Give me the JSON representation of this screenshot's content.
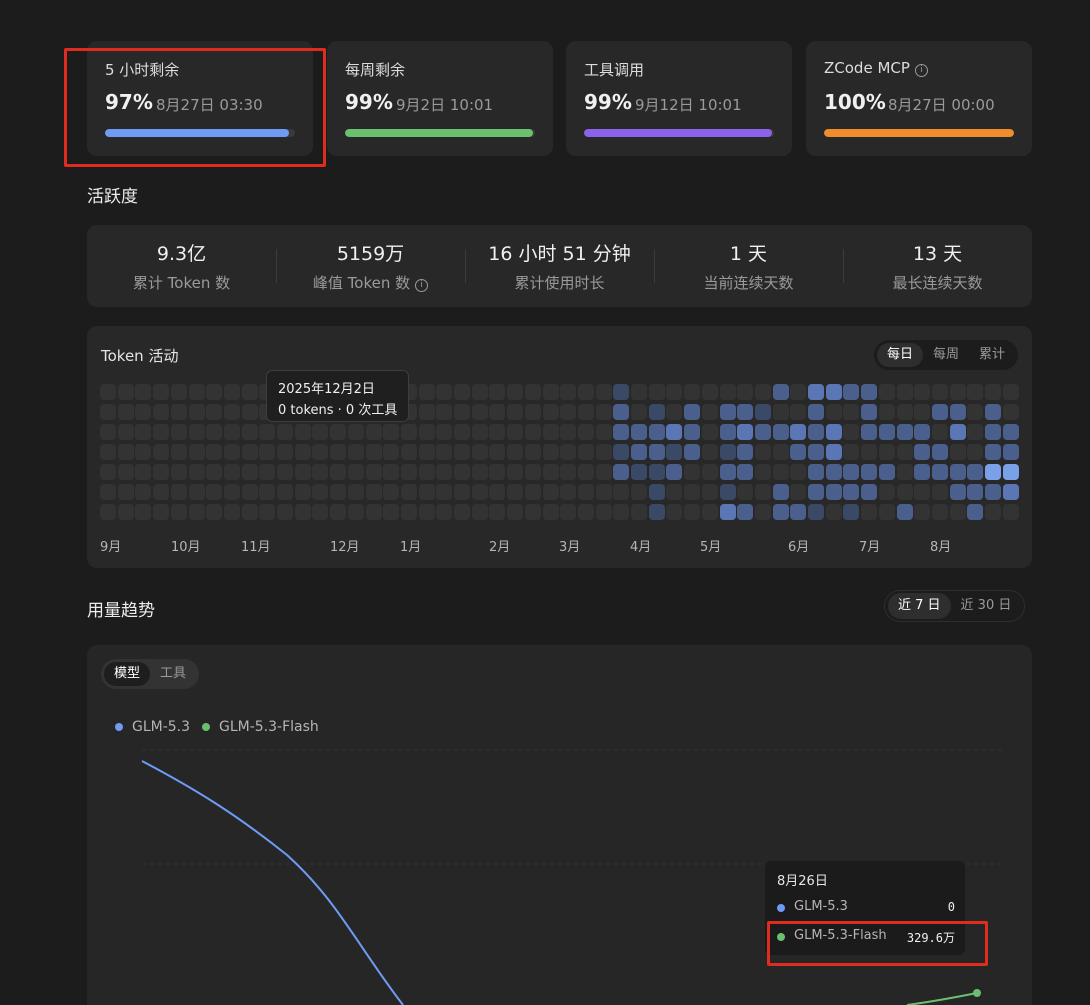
{
  "quota_cards": [
    {
      "title": "5 小时剩余",
      "percent": "97%",
      "reset": "8月27日 03:30",
      "fill": 0.97,
      "color": "#6f9bf5",
      "info": false
    },
    {
      "title": "每周剩余",
      "percent": "99%",
      "reset": "9月2日 10:01",
      "fill": 0.99,
      "color": "#6ac06f",
      "info": false
    },
    {
      "title": "工具调用",
      "percent": "99%",
      "reset": "9月12日 10:01",
      "fill": 0.99,
      "color": "#8a63e8",
      "info": false
    },
    {
      "title": "ZCode MCP",
      "percent": "100%",
      "reset": "8月27日 00:00",
      "fill": 1.0,
      "color": "#f08c2a",
      "info": true
    }
  ],
  "activity": {
    "section_title": "活跃度",
    "stats": [
      {
        "value": "9.3亿",
        "label": "累计 Token 数",
        "info": false
      },
      {
        "value": "5159万",
        "label": "峰值 Token 数",
        "info": true
      },
      {
        "value": "16 小时 51 分钟",
        "label": "累计使用时长",
        "info": false
      },
      {
        "value": "1 天",
        "label": "当前连续天数",
        "info": false
      },
      {
        "value": "13 天",
        "label": "最长连续天数",
        "info": false
      }
    ],
    "heatmap_title": "Token 活动",
    "tabs": [
      "每日",
      "每周",
      "累计"
    ],
    "active_tab": "每日",
    "months": [
      "9月",
      "10月",
      "11月",
      "12月",
      "1月",
      "2月",
      "3月",
      "4月",
      "5月",
      "6月",
      "7月",
      "8月"
    ],
    "tooltip": {
      "date": "2025年12月2日",
      "detail": "0 tokens · 0 次工具"
    },
    "levels": {
      "weeks": 52,
      "active": [
        [
          29,
          0,
          1
        ],
        [
          29,
          1,
          2
        ],
        [
          29,
          2,
          2
        ],
        [
          29,
          3,
          1
        ],
        [
          29,
          4,
          2
        ],
        [
          30,
          2,
          2
        ],
        [
          30,
          3,
          2
        ],
        [
          30,
          4,
          1
        ],
        [
          31,
          1,
          1
        ],
        [
          31,
          2,
          2
        ],
        [
          31,
          3,
          2
        ],
        [
          31,
          4,
          1
        ],
        [
          31,
          5,
          1
        ],
        [
          31,
          6,
          1
        ],
        [
          32,
          2,
          3
        ],
        [
          32,
          3,
          1
        ],
        [
          32,
          4,
          2
        ],
        [
          33,
          1,
          2
        ],
        [
          33,
          2,
          2
        ],
        [
          33,
          3,
          2
        ],
        [
          35,
          1,
          2
        ],
        [
          35,
          2,
          2
        ],
        [
          35,
          3,
          1
        ],
        [
          35,
          4,
          2
        ],
        [
          35,
          5,
          1
        ],
        [
          35,
          6,
          3
        ],
        [
          36,
          1,
          2
        ],
        [
          36,
          2,
          3
        ],
        [
          36,
          3,
          2
        ],
        [
          36,
          4,
          2
        ],
        [
          36,
          6,
          2
        ],
        [
          37,
          1,
          1
        ],
        [
          37,
          2,
          2
        ],
        [
          38,
          0,
          2
        ],
        [
          38,
          2,
          2
        ],
        [
          38,
          5,
          2
        ],
        [
          38,
          6,
          2
        ],
        [
          39,
          2,
          3
        ],
        [
          39,
          3,
          2
        ],
        [
          39,
          6,
          2
        ],
        [
          40,
          0,
          3
        ],
        [
          40,
          1,
          2
        ],
        [
          40,
          2,
          2
        ],
        [
          40,
          3,
          2
        ],
        [
          40,
          4,
          2
        ],
        [
          40,
          5,
          2
        ],
        [
          40,
          6,
          1
        ],
        [
          41,
          0,
          3
        ],
        [
          41,
          2,
          3
        ],
        [
          41,
          3,
          3
        ],
        [
          41,
          4,
          2
        ],
        [
          41,
          5,
          2
        ],
        [
          42,
          0,
          2
        ],
        [
          42,
          4,
          2
        ],
        [
          42,
          5,
          2
        ],
        [
          42,
          6,
          1
        ],
        [
          43,
          0,
          2
        ],
        [
          43,
          1,
          2
        ],
        [
          43,
          2,
          2
        ],
        [
          43,
          4,
          2
        ],
        [
          43,
          5,
          2
        ],
        [
          44,
          2,
          2
        ],
        [
          44,
          4,
          2
        ],
        [
          45,
          2,
          2
        ],
        [
          45,
          6,
          2
        ],
        [
          46,
          2,
          2
        ],
        [
          46,
          3,
          2
        ],
        [
          46,
          4,
          2
        ],
        [
          47,
          1,
          2
        ],
        [
          47,
          3,
          2
        ],
        [
          47,
          4,
          2
        ],
        [
          48,
          1,
          2
        ],
        [
          48,
          2,
          3
        ],
        [
          48,
          4,
          2
        ],
        [
          48,
          5,
          2
        ],
        [
          49,
          4,
          2
        ],
        [
          49,
          5,
          2
        ],
        [
          49,
          6,
          2
        ],
        [
          50,
          1,
          2
        ],
        [
          50,
          2,
          2
        ],
        [
          50,
          3,
          2
        ],
        [
          50,
          4,
          4
        ],
        [
          50,
          5,
          2
        ],
        [
          51,
          2,
          2
        ],
        [
          51,
          3,
          2
        ],
        [
          51,
          4,
          4
        ],
        [
          51,
          5,
          3
        ]
      ]
    }
  },
  "trend": {
    "section_title": "用量趋势",
    "range_tabs": [
      "近 7 日",
      "近 30 日"
    ],
    "active_range": "近 7 日",
    "type_tabs": [
      "模型",
      "工具"
    ],
    "active_type": "模型",
    "legend": [
      {
        "name": "GLM-5.3",
        "color": "#6f9bf5"
      },
      {
        "name": "GLM-5.3-Flash",
        "color": "#6ac06f"
      }
    ],
    "tooltip": {
      "date": "8月26日",
      "rows": [
        {
          "name": "GLM-5.3",
          "value": "0",
          "color": "#6f9bf5"
        },
        {
          "name": "GLM-5.3-Flash",
          "value": "329.6万",
          "color": "#6ac06f"
        }
      ]
    }
  }
}
